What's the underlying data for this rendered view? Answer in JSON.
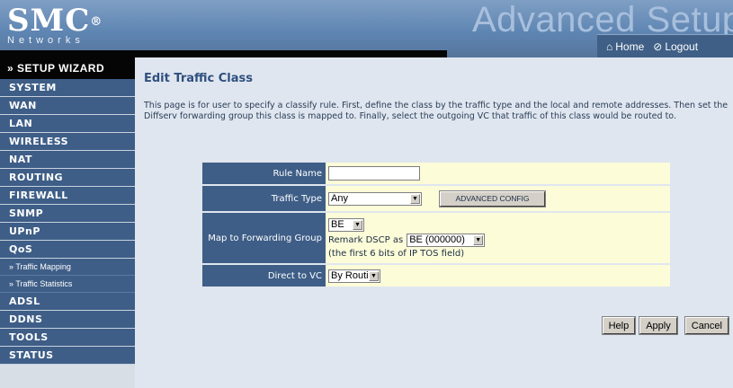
{
  "brand": {
    "name": "SMC",
    "reg": "®",
    "sub": "Networks",
    "banner": "Advanced Setup"
  },
  "topnav": {
    "home": "Home",
    "logout": "Logout"
  },
  "sidebar": {
    "wizard": "» SETUP WIZARD",
    "items": [
      "SYSTEM",
      "WAN",
      "LAN",
      "WIRELESS",
      "NAT",
      "ROUTING",
      "FIREWALL",
      "SNMP",
      "UPnP",
      "QoS"
    ],
    "qos_sub": [
      "» Traffic Mapping",
      "» Traffic Statistics"
    ],
    "items2": [
      "ADSL",
      "DDNS",
      "TOOLS",
      "STATUS"
    ]
  },
  "page": {
    "title": "Edit Traffic Class",
    "description": "This page is for user to specify a classify rule. First, define the class by the traffic type and the local and remote addresses. Then set the Diffserv forwarding group this class is mapped to. Finally, select the outgoing VC that traffic of this class would be routed to."
  },
  "form": {
    "rule_name_label": "Rule Name",
    "rule_name_value": "",
    "traffic_type_label": "Traffic Type",
    "traffic_type_value": "Any",
    "advanced_config": "ADVANCED CONFIG",
    "map_label": "Map to Forwarding Group",
    "group_value": "BE",
    "remark_label": "Remark DSCP as",
    "remark_value": "BE (000000)",
    "remark_note": "(the first 6 bits of IP TOS field)",
    "direct_label": "Direct to VC",
    "direct_value": "By Routing"
  },
  "buttons": {
    "help": "Help",
    "apply": "Apply",
    "cancel": "Cancel"
  },
  "colors": {
    "nav": "#3e5e87",
    "field_bg": "#fdfcd8",
    "title": "#2f4f7f"
  }
}
